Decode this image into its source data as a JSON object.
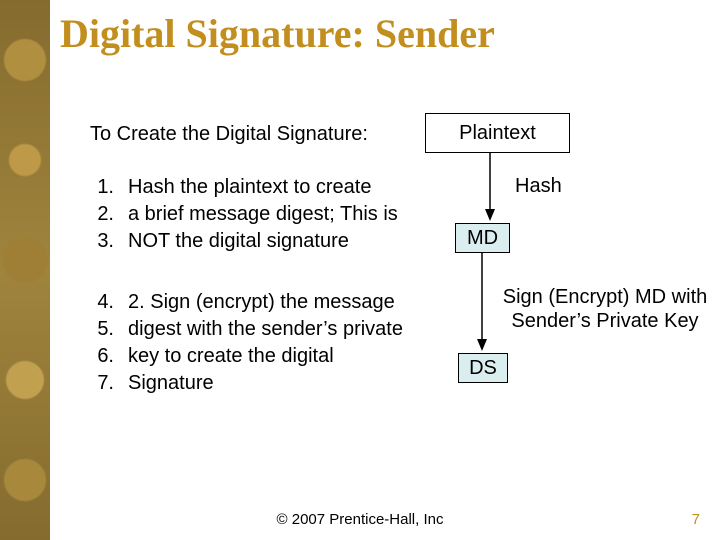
{
  "title": "Digital Signature: Sender",
  "intro": "To Create the Digital Signature:",
  "listA": {
    "n1": "1.",
    "t1": "Hash the plaintext to create",
    "n2": "2.",
    "t2": "a brief message digest; This is",
    "n3": "3.",
    "t3": "NOT the digital signature"
  },
  "listB": {
    "n1": "4.",
    "t1": "2. Sign (encrypt) the message",
    "n2": "5.",
    "t2": "digest with the sender’s private",
    "n3": "6.",
    "t3": "key to create the digital",
    "n4": "7.",
    "t4": "Signature"
  },
  "diagram": {
    "plaintext": "Plaintext",
    "hash": "Hash",
    "md": "MD",
    "sign_line1": "Sign (Encrypt) MD with",
    "sign_line2": "Sender’s Private Key",
    "ds": "DS"
  },
  "footer": "© 2007 Prentice-Hall, Inc",
  "page": "7"
}
